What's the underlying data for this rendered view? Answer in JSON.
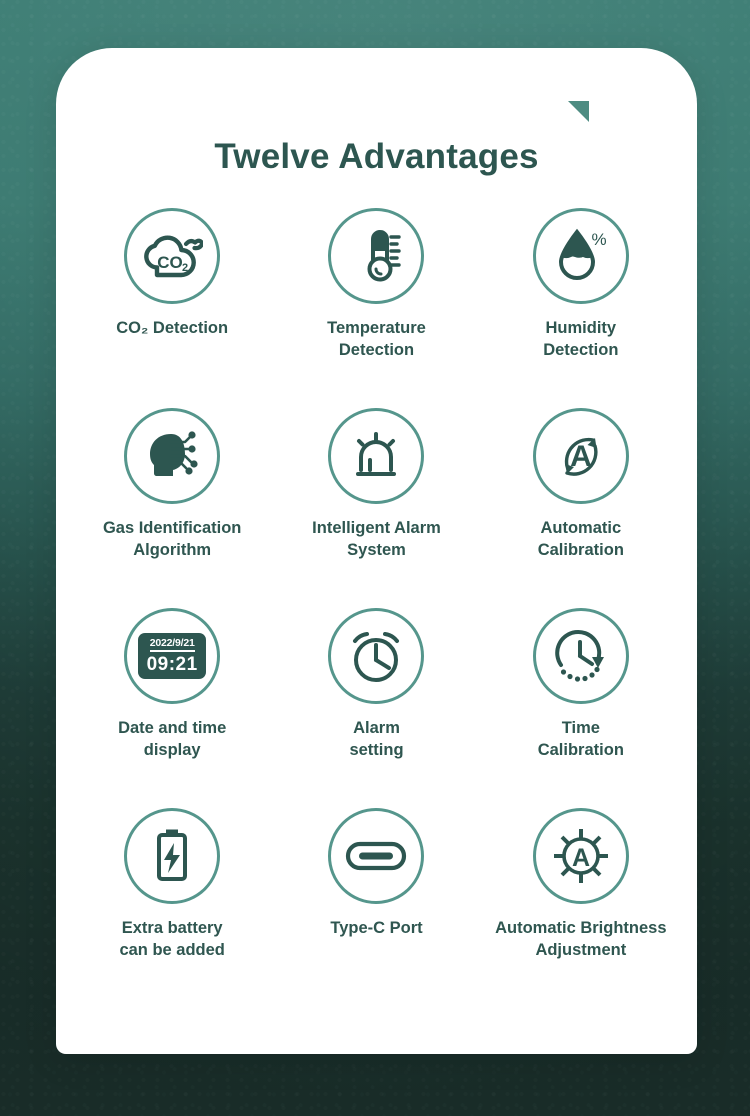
{
  "header": {
    "title": "Twelve Advantages",
    "accent_color": "#4e8c82",
    "title_color": "#2d5650"
  },
  "theme": {
    "ring_color": "#55968c",
    "icon_color": "#2d5650",
    "card_background": "#ffffff",
    "background_top": "#3e7e75",
    "background_bottom": "#1d3530",
    "caption_color": "#2f5650"
  },
  "features": [
    {
      "id": "co2-detection",
      "icon": "co2-cloud-icon",
      "label": "CO₂ Detection"
    },
    {
      "id": "temperature-detection",
      "icon": "thermometer-icon",
      "label": "Temperature\nDetection"
    },
    {
      "id": "humidity-detection",
      "icon": "humidity-droplet-icon",
      "label": "Humidity\nDetection"
    },
    {
      "id": "gas-identification",
      "icon": "ai-head-circuit-icon",
      "label": "Gas Identification\nAlgorithm"
    },
    {
      "id": "intelligent-alarm",
      "icon": "alarm-beacon-icon",
      "label": "Intelligent Alarm\nSystem"
    },
    {
      "id": "automatic-calibration",
      "icon": "auto-calibration-a-icon",
      "label": "Automatic\nCalibration"
    },
    {
      "id": "date-time-display",
      "icon": "digital-clock-icon",
      "label": "Date and time\ndisplay"
    },
    {
      "id": "alarm-setting",
      "icon": "alarm-clock-icon",
      "label": "Alarm\nsetting"
    },
    {
      "id": "time-calibration",
      "icon": "time-calibration-icon",
      "label": "Time\nCalibration"
    },
    {
      "id": "extra-battery",
      "icon": "battery-bolt-icon",
      "label": "Extra battery\ncan be added"
    },
    {
      "id": "type-c-port",
      "icon": "usb-c-port-icon",
      "label": "Type-C Port"
    },
    {
      "id": "automatic-brightness",
      "icon": "auto-brightness-sun-icon",
      "label": "Automatic Brightness\nAdjustment"
    }
  ],
  "digital_clock": {
    "date": "2022/9/21",
    "time": "09:21"
  },
  "icon_glyph_text": {
    "co2_label": "CO",
    "co2_subscript": "2",
    "humidity_percent": "%",
    "calibration_letter": "A",
    "brightness_letter": "A"
  }
}
